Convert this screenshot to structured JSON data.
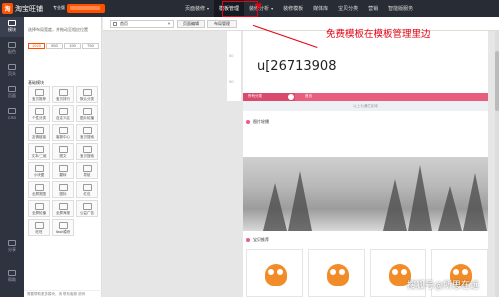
{
  "app": {
    "logo_text": "淘宝旺铺",
    "logo_badge": "专业版"
  },
  "nav": [
    {
      "label": "页面装修",
      "arrow": true,
      "active": false
    },
    {
      "label": "模板管理",
      "arrow": false,
      "active": true
    },
    {
      "label": "装修分析",
      "arrow": true,
      "active": false
    },
    {
      "label": "装修模板",
      "arrow": false,
      "active": false
    },
    {
      "label": "媒体库",
      "arrow": false,
      "active": false
    },
    {
      "label": "宝贝分类",
      "arrow": false,
      "active": false
    },
    {
      "label": "营销",
      "arrow": false,
      "active": false
    },
    {
      "label": "智能版服务",
      "arrow": false,
      "active": false
    }
  ],
  "rail": [
    {
      "label": "模块",
      "icon": "module-icon",
      "active": true
    },
    {
      "label": "配色",
      "icon": "palette-icon",
      "active": false
    },
    {
      "label": "页头",
      "icon": "header-icon",
      "active": false
    },
    {
      "label": "页面",
      "icon": "page-icon",
      "active": false
    },
    {
      "label": "CSS",
      "icon": "code-icon",
      "active": false
    },
    {
      "label": "分享",
      "icon": "share-icon",
      "active": false
    },
    {
      "label": "帮助",
      "icon": "help-icon",
      "active": false
    }
  ],
  "panel": {
    "tip": "选择布局宽度，并拖动至相应位置",
    "sizes": [
      {
        "label": "1920",
        "active": true
      },
      {
        "label": "950",
        "active": false
      },
      {
        "label": "190",
        "active": false
      },
      {
        "label": "750",
        "active": false
      }
    ],
    "section_title": "基础模块",
    "modules": [
      "宝贝推荐",
      "宝贝排行",
      "默认分类",
      "个性分类",
      "自定义区",
      "图片轮播",
      "友情链接",
      "客服中心",
      "宝贝搜索",
      "文本/二维",
      "图文",
      "宝贝搜索",
      "小块图",
      "翻转",
      "导航",
      "全屏宽图",
      "图标",
      "红包",
      "全屏轮播",
      "全屏海报",
      "公益广告",
      "旺旺",
      "flash模块"
    ],
    "footer": "需要帮助更多模块，请 联系客服 说明"
  },
  "toolbar": {
    "page_select": "首页",
    "btn_page_manage": "页面编辑",
    "btn_layout_manage": "布局管理"
  },
  "ruler": {
    "marks": [
      "50",
      "50"
    ]
  },
  "page": {
    "shop_name": "u[26713908",
    "nav_strip": {
      "category": "所有分类",
      "home": "首页"
    },
    "below_strip": "以上为通栏区域",
    "sec_carousel": "图片轮播",
    "sec_recommend": "宝贝推荐"
  },
  "annotation": {
    "text": "免费模板在模板管理里边"
  },
  "watermark": "搜狐号@所思在远",
  "colors": {
    "accent": "#ff5000",
    "annotation": "#e60012",
    "nav_bg": "#282c34",
    "shop_nav": "#e95d7f"
  }
}
